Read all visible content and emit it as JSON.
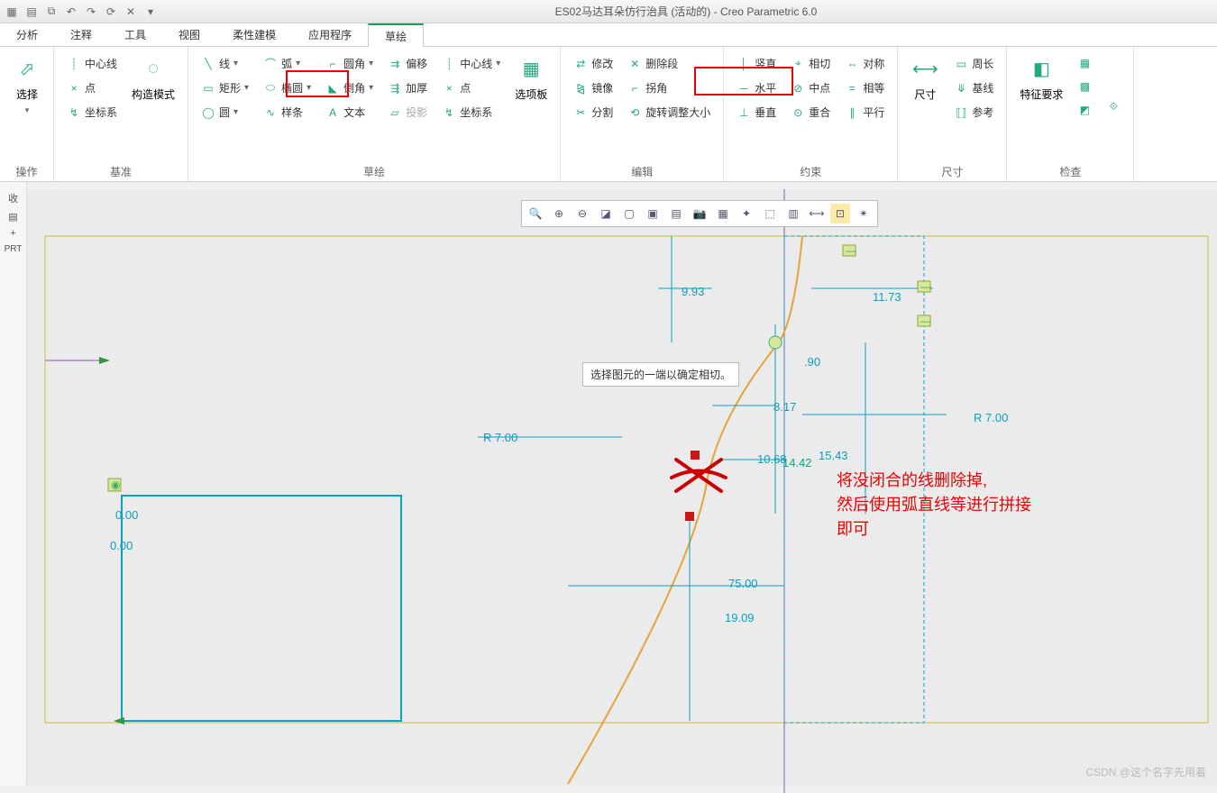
{
  "title": "ES02马达耳朵仿行治具 (活动的) - Creo Parametric 6.0",
  "qat": [
    "new",
    "open",
    "save",
    "undo",
    "redo",
    "regen",
    "close",
    "dd"
  ],
  "tabs": [
    "分析",
    "注释",
    "工具",
    "视图",
    "柔性建模",
    "应用程序",
    "草绘"
  ],
  "active_tab": 6,
  "ribbon": {
    "op": {
      "title": "操作",
      "select": "选择"
    },
    "datum": {
      "title": "基准",
      "centerline": "中心线",
      "point": "点",
      "coord": "坐标系",
      "construct": "构造模式"
    },
    "sketch": {
      "title": "草绘",
      "line": "线",
      "arc": "弧",
      "rect": "矩形",
      "ellipse": "椭圆",
      "circle": "圆",
      "spline": "样条",
      "fillet": "圆角",
      "chamfer": "倒角",
      "text": "文本",
      "offset": "偏移",
      "thicken": "加厚",
      "project": "投影",
      "centerline2": "中心线",
      "point2": "点",
      "coord2": "坐标系",
      "palette": "选项板"
    },
    "edit": {
      "title": "编辑",
      "modify": "修改",
      "delseg": "删除段",
      "mirror": "镜像",
      "corner": "拐角",
      "divide": "分割",
      "rotres": "旋转调整大小"
    },
    "constrain": {
      "title": "约束",
      "vert": "竖直",
      "horiz": "水平",
      "perp": "垂直",
      "tangent": "相切",
      "mid": "中点",
      "coinc": "重合",
      "sym": "对称",
      "equal": "相等",
      "parallel": "平行"
    },
    "dim": {
      "title": "尺寸",
      "dim": "尺寸",
      "perim": "周长",
      "baseline": "基线",
      "ref": "参考"
    },
    "inspect": {
      "title": "检查",
      "req": "特征要求"
    }
  },
  "toolbar_icons": [
    "zoom-fit",
    "zoom-in",
    "zoom-out",
    "refit",
    "view-normal",
    "saved-views",
    "named-views",
    "view-mgr",
    "layers",
    "spin",
    "3d-box",
    "grid",
    "show-dims",
    "highlight",
    "pick"
  ],
  "tooltip": "选择图元的一端以确定相切。",
  "dims": {
    "d993": "9.93",
    "d1173": "11.73",
    "d90": ".90",
    "d817": "8.17",
    "r7a": "R 7.00",
    "r7b": "R 7.00",
    "d1068": "10.68",
    "d1442": "14.42",
    "d1543": "15.43",
    "d75": "75.00",
    "d1909": "19.09",
    "d000a": "0.00",
    "d000b": "0.00"
  },
  "annotation": "将没闭合的线删除掉,\n然后使用弧直线等进行拼接\n即可",
  "side": {
    "collapse": "收",
    "tree": "PRT"
  },
  "watermark": "CSDN @这个名字先用着"
}
